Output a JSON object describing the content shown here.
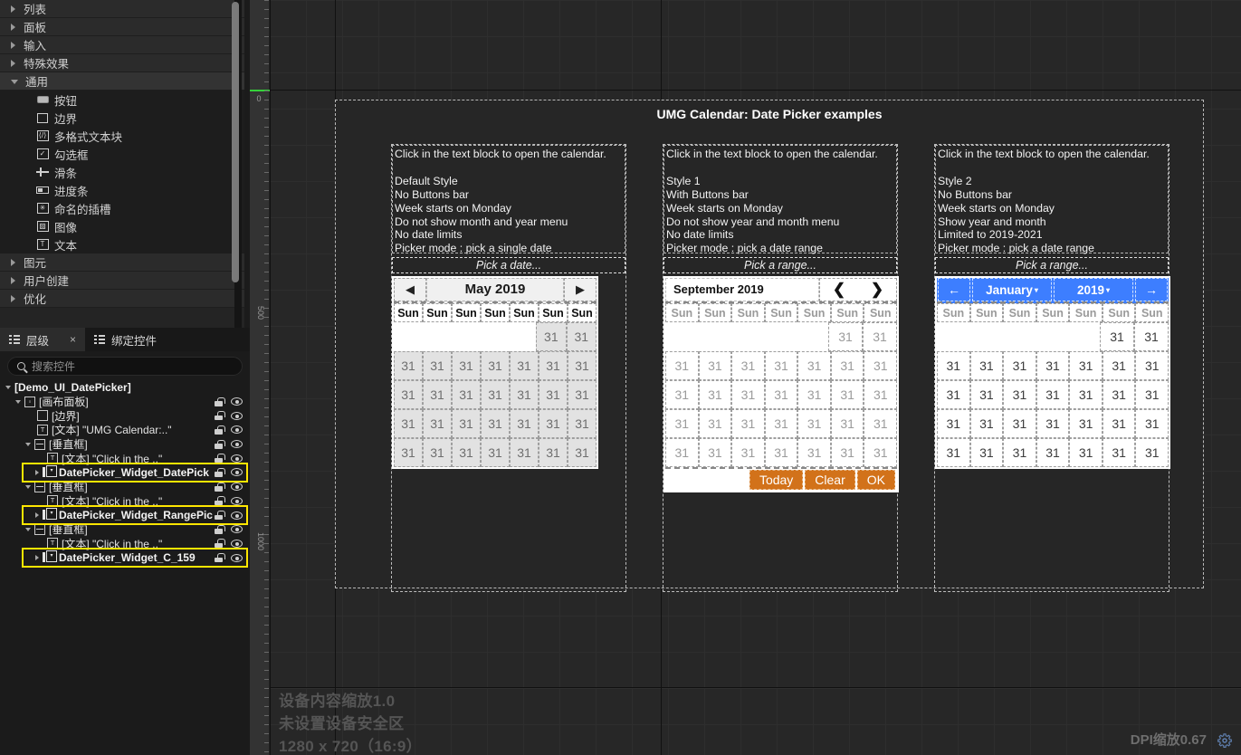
{
  "palette": {
    "categories": [
      {
        "label": "列表",
        "expanded": false
      },
      {
        "label": "面板",
        "expanded": false
      },
      {
        "label": "输入",
        "expanded": false
      },
      {
        "label": "特殊效果",
        "expanded": false
      },
      {
        "label": "通用",
        "expanded": true
      }
    ],
    "items": [
      {
        "label": "按钮",
        "icon": "button-icon"
      },
      {
        "label": "边界",
        "icon": "border-icon"
      },
      {
        "label": "多格式文本块",
        "icon": "rich-text-icon"
      },
      {
        "label": "勾选框",
        "icon": "checkbox-icon"
      },
      {
        "label": "滑条",
        "icon": "slider-icon"
      },
      {
        "label": "进度条",
        "icon": "progressbar-icon"
      },
      {
        "label": "命名的插槽",
        "icon": "named-slot-icon"
      },
      {
        "label": "图像",
        "icon": "image-icon"
      },
      {
        "label": "文本",
        "icon": "text-icon"
      }
    ],
    "categories_bottom": [
      {
        "label": "图元",
        "expanded": false
      },
      {
        "label": "用户创建",
        "expanded": false
      },
      {
        "label": "优化",
        "expanded": false
      }
    ]
  },
  "hierarchy": {
    "tabs": [
      {
        "label": "层级",
        "active": true,
        "closable": true
      },
      {
        "label": "绑定控件",
        "active": false,
        "closable": false
      }
    ],
    "close_label": "×",
    "search_placeholder": "搜索控件",
    "search_value": "",
    "tree": [
      {
        "indent": 0,
        "arrow": "down",
        "icon": "none",
        "label": "[Demo_UI_DatePicker]",
        "bold": true,
        "controls": false,
        "highlight": false
      },
      {
        "indent": 1,
        "arrow": "down",
        "icon": "canvas",
        "label": "[画布面板]",
        "bold": false,
        "controls": true,
        "highlight": false
      },
      {
        "indent": 2,
        "arrow": "none",
        "icon": "border",
        "label": "[边界]",
        "bold": false,
        "controls": true,
        "highlight": false
      },
      {
        "indent": 2,
        "arrow": "none",
        "icon": "text",
        "label": "[文本] \"UMG Calendar:..\"",
        "bold": false,
        "controls": true,
        "highlight": false
      },
      {
        "indent": 2,
        "arrow": "down",
        "icon": "vbox",
        "label": "[垂直框]",
        "bold": false,
        "controls": true,
        "highlight": false
      },
      {
        "indent": 3,
        "arrow": "none",
        "icon": "text",
        "label": "[文本] \"Click in the ..\"",
        "bold": false,
        "controls": true,
        "highlight": false
      },
      {
        "indent": 3,
        "arrow": "right",
        "icon": "datepicker",
        "label": "DatePicker_Widget_DatePick",
        "bold": true,
        "controls": true,
        "highlight": true
      },
      {
        "indent": 2,
        "arrow": "down",
        "icon": "vbox",
        "label": "[垂直框]",
        "bold": false,
        "controls": true,
        "highlight": false
      },
      {
        "indent": 3,
        "arrow": "none",
        "icon": "text",
        "label": "[文本] \"Click in the ..\"",
        "bold": false,
        "controls": true,
        "highlight": false
      },
      {
        "indent": 3,
        "arrow": "right",
        "icon": "datepicker",
        "label": "DatePicker_Widget_RangePic",
        "bold": true,
        "controls": true,
        "highlight": true
      },
      {
        "indent": 2,
        "arrow": "down",
        "icon": "vbox",
        "label": "[垂直框]",
        "bold": false,
        "controls": true,
        "highlight": false
      },
      {
        "indent": 3,
        "arrow": "none",
        "icon": "text",
        "label": "[文本] \"Click in the ..\"",
        "bold": false,
        "controls": true,
        "highlight": false
      },
      {
        "indent": 3,
        "arrow": "right",
        "icon": "datepicker",
        "label": "DatePicker_Widget_C_159",
        "bold": true,
        "controls": true,
        "highlight": true
      }
    ]
  },
  "ruler": {
    "labels": [
      "0",
      "500",
      "1000"
    ]
  },
  "canvas": {
    "surface_title": "UMG Calendar: Date Picker examples",
    "notes": [
      "设备内容缩放1.0",
      "未设置设备安全区",
      "1280 x 720（16:9）"
    ],
    "dpi_label": "DPI缩放0.67",
    "gear_icon": "gear-icon",
    "resize_icon": "resize-handle-icon"
  },
  "panels": [
    {
      "id": "panel0",
      "style_class": "s0",
      "description_lines": [
        "Click in the text block to open the calendar.",
        "",
        "Default Style",
        "No Buttons bar",
        "Week starts on Monday",
        "Do not show month and year menu",
        "No date limits",
        "Picker mode : pick a single date"
      ],
      "picker_placeholder": "Pick a date...",
      "calendar": {
        "header_style": "style0",
        "title": "May 2019",
        "prev_icon": "◀",
        "next_icon": "▶",
        "weekdays": [
          "Sun",
          "Sun",
          "Sun",
          "Sun",
          "Sun",
          "Sun",
          "Sun"
        ],
        "weeks": [
          [
            "",
            "",
            "",
            "",
            "",
            "31",
            "31"
          ],
          [
            "31",
            "31",
            "31",
            "31",
            "31",
            "31",
            "31"
          ],
          [
            "31",
            "31",
            "31",
            "31",
            "31",
            "31",
            "31"
          ],
          [
            "31",
            "31",
            "31",
            "31",
            "31",
            "31",
            "31"
          ],
          [
            "31",
            "31",
            "31",
            "31",
            "31",
            "31",
            "31"
          ]
        ],
        "buttons_bar": null
      }
    },
    {
      "id": "panel1",
      "style_class": "s1",
      "description_lines": [
        "Click in the text block to open the calendar.",
        "",
        "Style 1",
        "With Buttons bar",
        "Week starts on Monday",
        "Do not show year and month menu",
        "No date limits",
        "Picker mode : pick a date range"
      ],
      "picker_placeholder": "Pick a range...",
      "calendar": {
        "header_style": "style1",
        "title": "September 2019",
        "prev_icon": "❮",
        "next_icon": "❯",
        "weekdays": [
          "Sun",
          "Sun",
          "Sun",
          "Sun",
          "Sun",
          "Sun",
          "Sun"
        ],
        "weeks": [
          [
            "",
            "",
            "",
            "",
            "",
            "31",
            "31"
          ],
          [
            "31",
            "31",
            "31",
            "31",
            "31",
            "31",
            "31"
          ],
          [
            "31",
            "31",
            "31",
            "31",
            "31",
            "31",
            "31"
          ],
          [
            "31",
            "31",
            "31",
            "31",
            "31",
            "31",
            "31"
          ],
          [
            "31",
            "31",
            "31",
            "31",
            "31",
            "31",
            "31"
          ]
        ],
        "buttons_bar": [
          "Today",
          "Clear",
          "OK"
        ],
        "buttons_color": "#d2721a"
      }
    },
    {
      "id": "panel2",
      "style_class": "s2",
      "description_lines": [
        "Click in the text block to open the calendar.",
        "",
        "Style 2",
        "No Buttons bar",
        "Week starts on Monday",
        "Show year and month",
        "Limited to 2019-2021",
        "Picker mode : pick a date range"
      ],
      "picker_placeholder": "Pick a range...",
      "calendar": {
        "header_style": "style2",
        "header_color": "#3d7eff",
        "month_select": "January",
        "year_select": "2019",
        "prev_icon": "←",
        "next_icon": "→",
        "weekdays": [
          "Sun",
          "Sun",
          "Sun",
          "Sun",
          "Sun",
          "Sun",
          "Sun"
        ],
        "weeks": [
          [
            "",
            "",
            "",
            "",
            "",
            "31",
            "31"
          ],
          [
            "31",
            "31",
            "31",
            "31",
            "31",
            "31",
            "31"
          ],
          [
            "31",
            "31",
            "31",
            "31",
            "31",
            "31",
            "31"
          ],
          [
            "31",
            "31",
            "31",
            "31",
            "31",
            "31",
            "31"
          ],
          [
            "31",
            "31",
            "31",
            "31",
            "31",
            "31",
            "31"
          ]
        ],
        "buttons_bar": null
      }
    }
  ]
}
